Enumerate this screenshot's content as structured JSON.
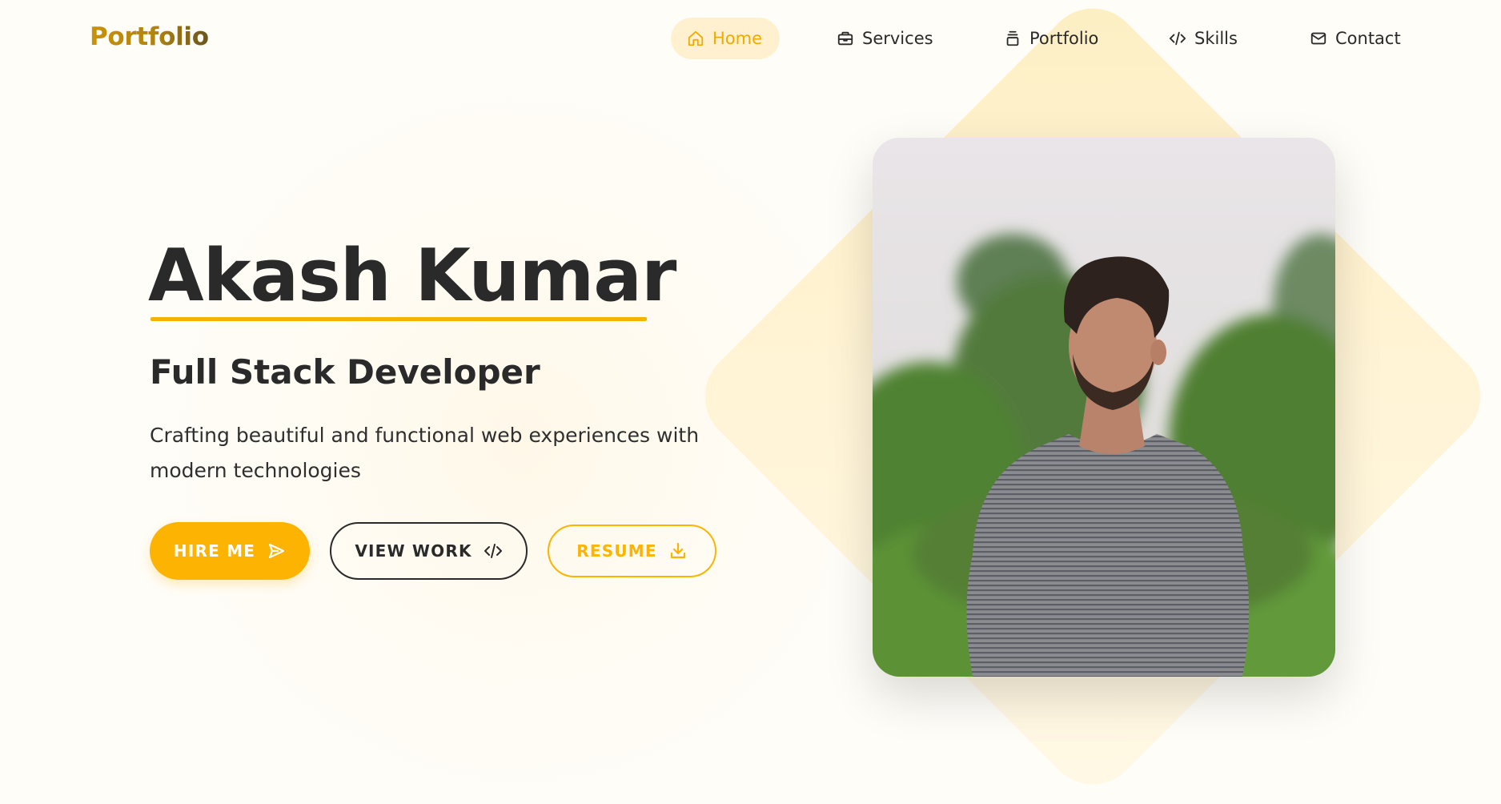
{
  "header": {
    "logo": "Portfolio"
  },
  "nav": {
    "items": [
      {
        "label": "Home",
        "icon": "home-icon",
        "active": true
      },
      {
        "label": "Services",
        "icon": "briefcase-icon",
        "active": false
      },
      {
        "label": "Portfolio",
        "icon": "layers-icon",
        "active": false
      },
      {
        "label": "Skills",
        "icon": "code-icon",
        "active": false
      },
      {
        "label": "Contact",
        "icon": "mail-icon",
        "active": false
      }
    ]
  },
  "hero": {
    "name": "Akash Kumar",
    "title": "Full Stack Developer",
    "description": "Crafting beautiful and functional web experiences with modern technologies",
    "buttons": {
      "hire": {
        "label": "HIRE ME",
        "icon": "send-icon"
      },
      "view": {
        "label": "VIEW WORK",
        "icon": "code-icon"
      },
      "resume": {
        "label": "RESUME",
        "icon": "download-icon"
      }
    }
  },
  "colors": {
    "accent": "#fdb302",
    "text": "#2a2a2a",
    "nav_active_bg": "#fff1cf",
    "background": "#fffdf8"
  }
}
